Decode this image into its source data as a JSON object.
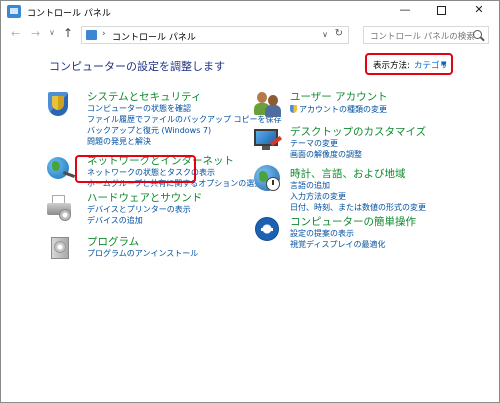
{
  "window": {
    "title": "コントロール パネル",
    "buttons": {
      "minimize": "—",
      "maximize": "",
      "close": "✕"
    }
  },
  "nav": {
    "back": "←",
    "forward": "→",
    "recent": "∨",
    "up": "↑",
    "address_separator": "›",
    "address": "コントロール パネル",
    "address_dropdown": "∨",
    "refresh": "↻",
    "search_placeholder": "コントロール パネルの検索"
  },
  "page": {
    "heading": "コンピューターの設定を調整します",
    "view_by_label": "表示方法:",
    "view_by_value": "カテゴリ",
    "view_by_arrow": "▼"
  },
  "categories": {
    "system_security": {
      "title": "システムとセキュリティ",
      "links": [
        "コンピューターの状態を確認",
        "ファイル履歴でファイルのバックアップ コピーを保存",
        "バックアップと復元 (Windows 7)",
        "問題の発見と解決"
      ]
    },
    "network": {
      "title": "ネットワークとインターネット",
      "links": [
        "ネットワークの状態とタスクの表示",
        "ホームグループと共有に関するオプションの選択"
      ]
    },
    "hardware": {
      "title": "ハードウェアとサウンド",
      "links": [
        "デバイスとプリンターの表示",
        "デバイスの追加"
      ]
    },
    "programs": {
      "title": "プログラム",
      "links": [
        "プログラムのアンインストール"
      ]
    },
    "user_accounts": {
      "title": "ユーザー アカウント",
      "links": [
        "アカウントの種類の変更"
      ]
    },
    "appearance": {
      "title": "デスクトップのカスタマイズ",
      "links": [
        "テーマの変更",
        "画面の解像度の調整"
      ]
    },
    "clock_region": {
      "title": "時計、言語、および地域",
      "links": [
        "言語の追加",
        "入力方法の変更",
        "日付、時刻、または数値の形式の変更"
      ]
    },
    "ease_of_access": {
      "title": "コンピューターの簡単操作",
      "links": [
        "設定の提案の表示",
        "視覚ディスプレイの最適化"
      ]
    }
  },
  "colors": {
    "highlight": "#e60012",
    "category_title": "#0e8a2e",
    "link": "#0050a0",
    "heading": "#1e3287"
  }
}
